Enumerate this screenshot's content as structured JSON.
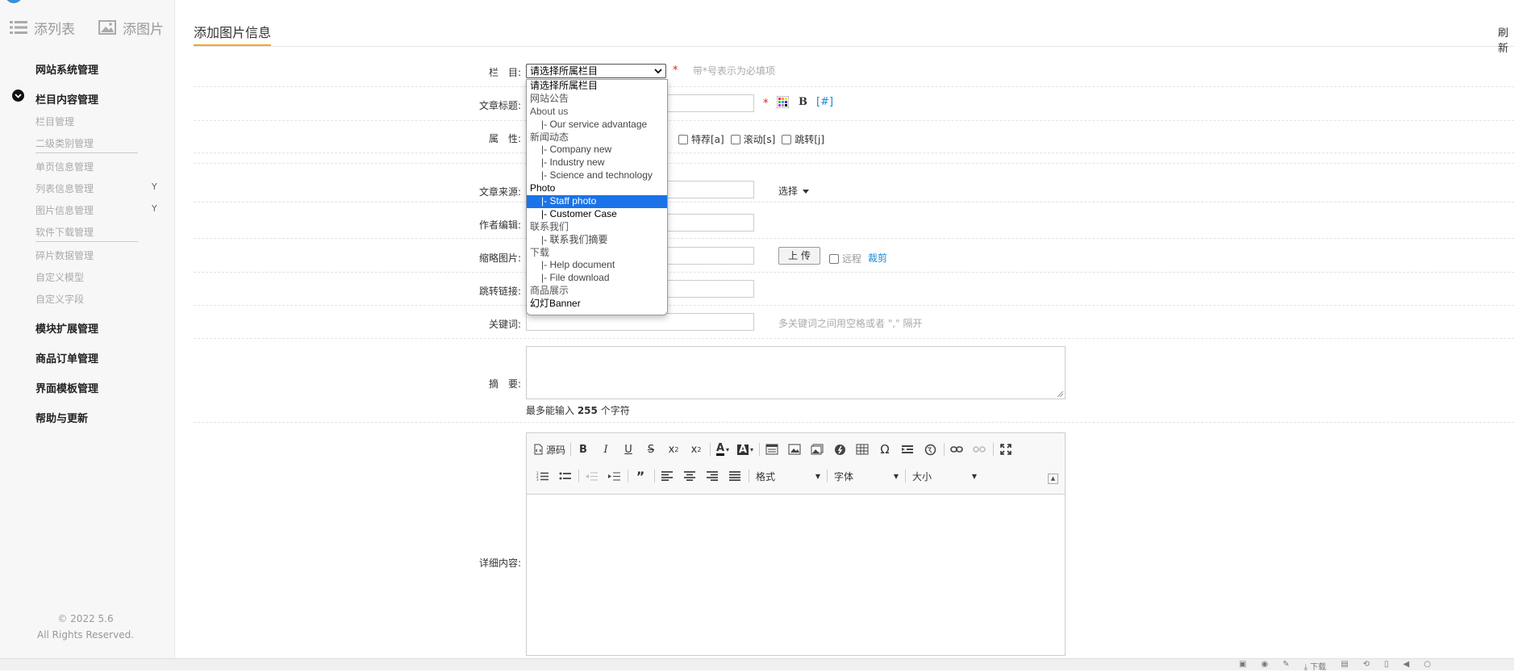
{
  "sidebar": {
    "quick_links": [
      {
        "label": "添列表",
        "icon": "list-icon"
      },
      {
        "label": "添图片",
        "icon": "image-icon"
      }
    ],
    "groups": [
      {
        "label": "网站系统管理"
      },
      {
        "label": "栏目内容管理"
      },
      {
        "label": "模块扩展管理"
      },
      {
        "label": "商品订单管理"
      },
      {
        "label": "界面模板管理"
      },
      {
        "label": "帮助与更新"
      }
    ],
    "sub_items": [
      {
        "label": "栏目管理"
      },
      {
        "label": "二级类别管理"
      },
      {
        "label": "单页信息管理"
      },
      {
        "label": "列表信息管理",
        "arrow": "Y"
      },
      {
        "label": "图片信息管理",
        "arrow": "Y"
      },
      {
        "label": "软件下载管理"
      },
      {
        "label": "碎片数据管理"
      },
      {
        "label": "自定义模型"
      },
      {
        "label": "自定义字段"
      }
    ],
    "copyright_line1": "© 2022 5.6",
    "copyright_line2": "All Rights Reserved."
  },
  "header": {
    "tab_title": "添加图片信息",
    "refresh_label": "刷新"
  },
  "form": {
    "category_label": "栏　目:",
    "category_selected": "请选择所属栏目",
    "required_note": "带*号表示为必填项",
    "title_label": "文章标题:",
    "title_bold_button": "B",
    "title_link_button": "[#]",
    "attr_label": "属　性:",
    "attr_partial": "]",
    "attributes": [
      "特荐[a]",
      "滚动[s]",
      "跳转[j]"
    ],
    "source_label": "文章来源:",
    "source_select": "选择",
    "author_label": "作者编辑:",
    "thumb_label": "缩略图片:",
    "upload_button": "上 传",
    "remote_label": "远程",
    "crop_link": "裁剪",
    "redirect_label": "跳转链接:",
    "keywords_label": "关键词:",
    "keywords_hint": "多关键词之间用空格或者 \",\" 隔开",
    "summary_label": "摘　要:",
    "max_chars_prefix": "最多能输入 ",
    "max_chars_value": "255",
    "max_chars_suffix": " 个字符",
    "content_label": "详细内容:"
  },
  "dropdown": {
    "options": [
      {
        "label": "请选择所属栏目",
        "level": 0,
        "style": "dark"
      },
      {
        "label": "网站公告",
        "level": 0
      },
      {
        "label": "About us",
        "level": 0
      },
      {
        "label": "|- Our service advantage",
        "level": 1
      },
      {
        "label": "新闻动态",
        "level": 0
      },
      {
        "label": "|- Company new",
        "level": 1
      },
      {
        "label": "|- Industry new",
        "level": 1
      },
      {
        "label": "|- Science and technology",
        "level": 1
      },
      {
        "label": "Photo",
        "level": 0,
        "style": "dark"
      },
      {
        "label": "|- Staff photo",
        "level": 1,
        "selected": true
      },
      {
        "label": "|- Customer Case",
        "level": 1,
        "style": "dark"
      },
      {
        "label": "联系我们",
        "level": 0
      },
      {
        "label": "|- 联系我们摘要",
        "level": 1
      },
      {
        "label": "下载",
        "level": 0
      },
      {
        "label": "|- Help document",
        "level": 1
      },
      {
        "label": "|- File download",
        "level": 1
      },
      {
        "label": "商品展示",
        "level": 0
      },
      {
        "label": "幻灯Banner",
        "level": 0,
        "style": "dark"
      }
    ]
  },
  "editor": {
    "source_label": "源码",
    "format_combo": "格式",
    "font_combo": "字体",
    "size_combo": "大小"
  },
  "statusbar": {
    "download_label": "下载"
  }
}
